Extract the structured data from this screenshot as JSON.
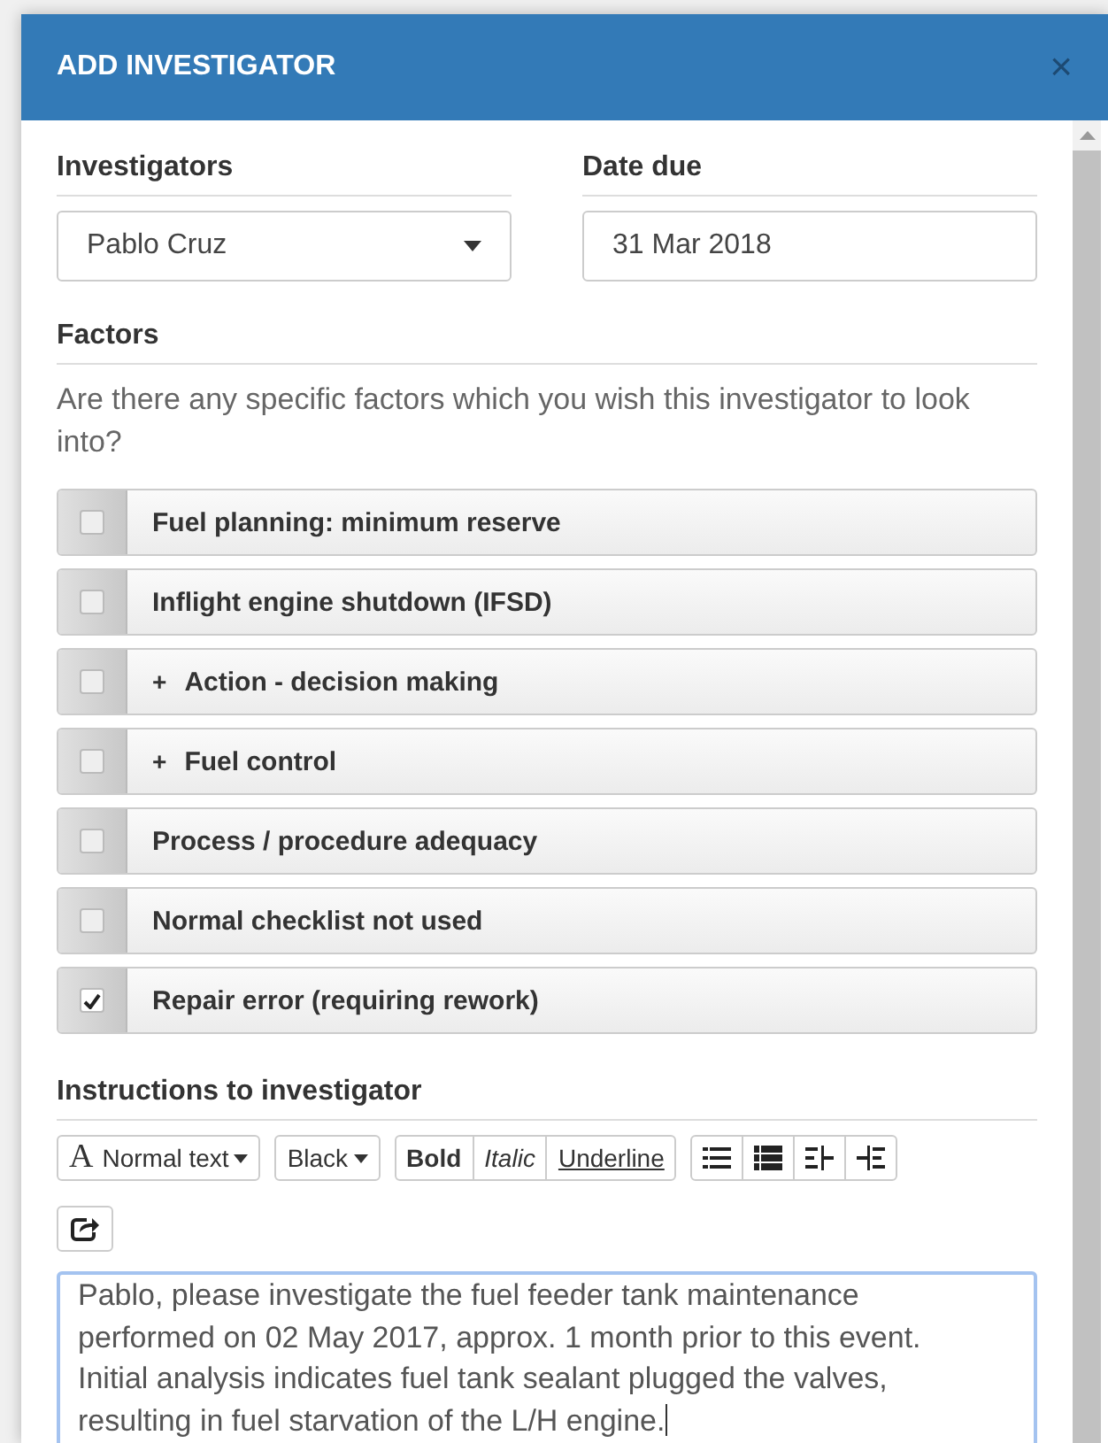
{
  "window": {
    "title": "ADD INVESTIGATOR",
    "close": "×"
  },
  "investigators": {
    "label": "Investigators",
    "value": "Pablo Cruz"
  },
  "date_due": {
    "label": "Date due",
    "value": "31 Mar 2018"
  },
  "factors": {
    "label": "Factors",
    "question": "Are there any specific factors which you wish this investigator to look into?",
    "items": [
      {
        "label": "Fuel planning: minimum reserve",
        "checked": false,
        "expandable": false
      },
      {
        "label": "Inflight engine shutdown (IFSD)",
        "checked": false,
        "expandable": false
      },
      {
        "label": "Action - decision making",
        "checked": false,
        "expandable": true,
        "expand_mark": "+"
      },
      {
        "label": "Fuel control",
        "checked": false,
        "expandable": true,
        "expand_mark": "+"
      },
      {
        "label": "Process / procedure adequacy",
        "checked": false,
        "expandable": false
      },
      {
        "label": "Normal checklist not used",
        "checked": false,
        "expandable": false
      },
      {
        "label": "Repair error (requiring rework)",
        "checked": true,
        "expandable": false
      }
    ]
  },
  "instructions": {
    "label": "Instructions to investigator",
    "toolbar": [
      {
        "kind": "dropdown",
        "glyph": "A",
        "label": "Normal text"
      },
      {
        "kind": "dropdown",
        "label": "Black"
      },
      {
        "kind": "group",
        "buttons": [
          {
            "kind": "bold",
            "label": "Bold"
          },
          {
            "kind": "italic",
            "label": "Italic"
          },
          {
            "kind": "underline",
            "label": "Underline"
          }
        ]
      },
      {
        "kind": "group",
        "buttons": [
          {
            "kind": "bullet-list"
          },
          {
            "kind": "numbered-list"
          },
          {
            "kind": "outdent"
          },
          {
            "kind": "indent"
          }
        ]
      }
    ],
    "text": "Pablo, please investigate the fuel feeder tank maintenance performed on 02 May 2017, approx. 1 month prior to this event. Initial analysis indicates fuel tank sealant plugged the valves, resulting in fuel starvation of the L/H engine."
  }
}
